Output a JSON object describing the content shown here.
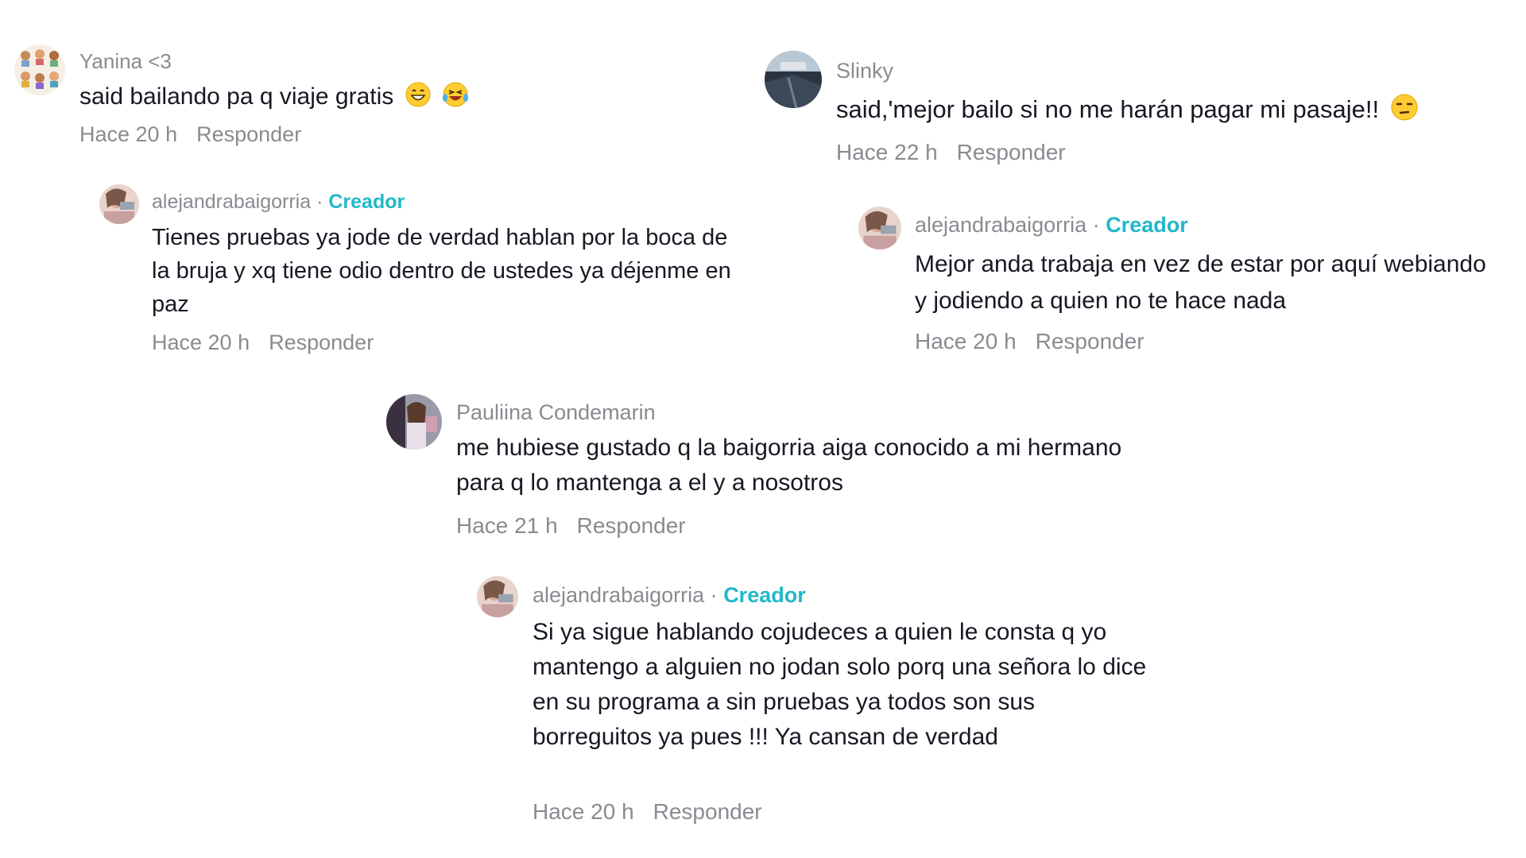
{
  "comments": [
    {
      "user": "Yanina <3",
      "text": "said bailando pa q viaje gratis",
      "time": "Hace 20 h",
      "reply": "Responder"
    },
    {
      "user": "alejandrabaigorria",
      "badge": "Creador",
      "text": "Tienes pruebas ya jode de verdad hablan por la boca de la bruja y xq tiene odio dentro de ustedes ya déjenme en paz",
      "time": "Hace 20 h",
      "reply": "Responder"
    },
    {
      "user": "Slinky",
      "text": "said,'mejor bailo si no me harán pagar mi pasaje!!",
      "time": "Hace 22 h",
      "reply": "Responder"
    },
    {
      "user": "alejandrabaigorria",
      "badge": "Creador",
      "text": "Mejor anda trabaja en vez de estar por aquí webiando y jodiendo a quien no te hace nada",
      "time": "Hace 20 h",
      "reply": "Responder"
    },
    {
      "user": "Pauliina Condemarin",
      "text": "me hubiese gustado q la baigorria aiga conocido a mi hermano para q lo mantenga a el y a nosotros",
      "time": "Hace 21 h",
      "reply": "Responder"
    },
    {
      "user": "alejandrabaigorria",
      "badge": "Creador",
      "text": "Si ya sigue hablando cojudeces a quien le consta q yo mantengo a alguien no jodan solo porq una señora lo dice en su programa a sin pruebas ya todos son sus borreguitos ya pues !!! Ya cansan de verdad",
      "time": "Hace 20 h",
      "reply": "Responder"
    }
  ],
  "separator": "·",
  "icons": {
    "grin": "grinning-emoji-icon",
    "laugh": "laughing-tears-emoji-icon",
    "unamused": "unamused-emoji-icon"
  },
  "colors": {
    "text": "#161823",
    "muted": "#8a8b91",
    "creator": "#20b8c8"
  }
}
